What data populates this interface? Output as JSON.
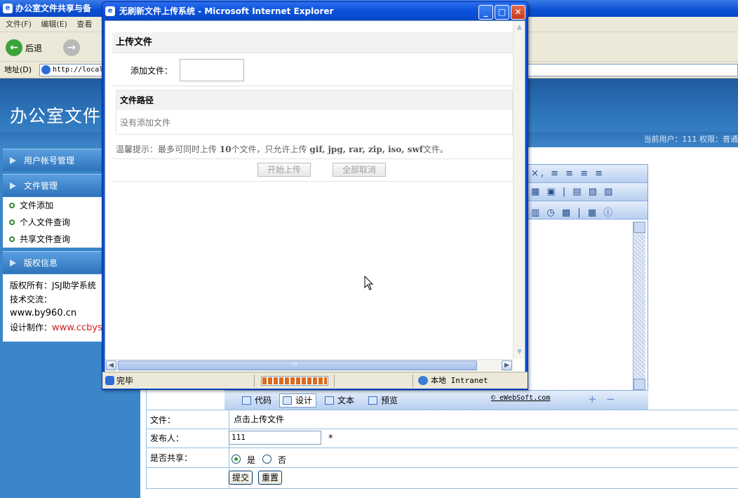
{
  "bg_window": {
    "title": "办公室文件共享与备",
    "menu": [
      "文件(F)",
      "编辑(E)",
      "查看"
    ],
    "back_label": "后退",
    "address_label": "地址(D)",
    "address_value": "http://local"
  },
  "page": {
    "site_title": "办公室文件",
    "user_info": "当前用户：111  权限：普通"
  },
  "sidebar": {
    "sections": [
      {
        "label": "用户帐号管理"
      },
      {
        "label": "文件管理"
      },
      {
        "label": "版权信息"
      }
    ],
    "file_items": [
      "文件添加",
      "个人文件查询",
      "共享文件查询"
    ],
    "copyright": {
      "owner": "版权所有：JSJ助学系统",
      "tech": "技术交流：",
      "url": "www.by960.cn",
      "design_label": "设计制作：",
      "design_url": "www.ccbys"
    }
  },
  "editor": {
    "modes": [
      "代码",
      "设计",
      "文本",
      "预览"
    ],
    "copyright": "© eWebSoft.com",
    "zoom_in": "+",
    "zoom_out": "−",
    "toolbar_row1": "×, ≡ ≡ ≡ ≡",
    "toolbar_row2": "▦ ▣ | ▤ ▧ ▨",
    "toolbar_row3": "▥ ◷ ▩ | ▦ ⓘ"
  },
  "form": {
    "file_label": "文件：",
    "file_value": "点击上传文件",
    "publisher_label": "发布人：",
    "publisher_value": "111",
    "required_mark": "*",
    "share_label": "是否共享：",
    "share_yes": "是",
    "share_no": "否",
    "submit": "提交",
    "reset": "重置"
  },
  "popup": {
    "title": "无刷新文件上传系统 - Microsoft Internet Explorer",
    "heading": "上传文件",
    "add_label": "添加文件：",
    "path_header": "文件路径",
    "path_empty": "没有添加文件",
    "tip_prefix": "温馨提示：最多可同时上传",
    "tip_count": "10",
    "tip_middle": "个文件，只允许上传",
    "tip_types": "gif, jpg, rar, zip, iso, swf",
    "tip_suffix": "文件。",
    "start_upload": "开始上传",
    "cancel_all": "全部取消",
    "status_text": "完毕",
    "status_zone": "本地 Intranet",
    "hscroll_grip": "III"
  }
}
